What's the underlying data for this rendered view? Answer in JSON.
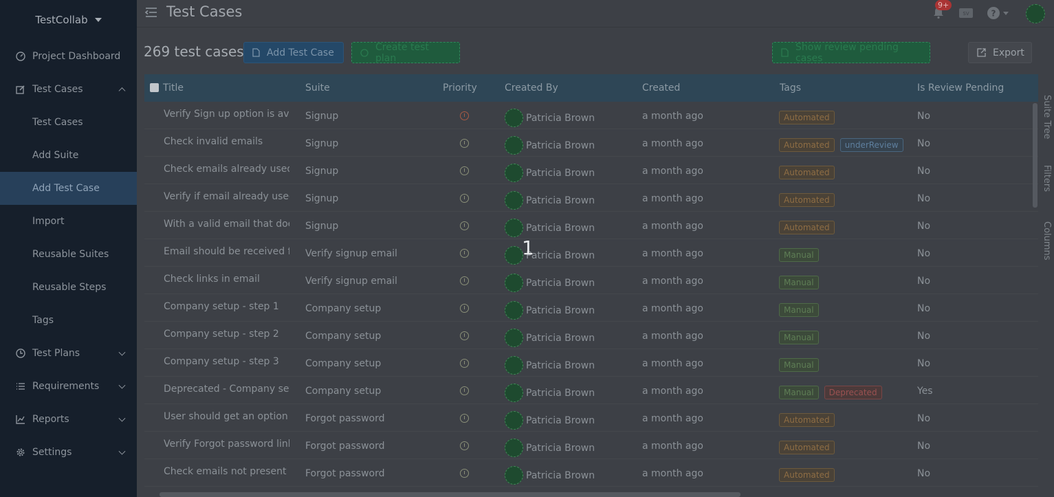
{
  "sidebar": {
    "brand": "TestCollab",
    "items": [
      {
        "label": "Project Dashboard",
        "icon": "dashboard-icon"
      },
      {
        "label": "Test Cases",
        "icon": "edit-icon"
      },
      {
        "label": "Test Cases"
      },
      {
        "label": "Add Suite"
      },
      {
        "label": "Add Test Case"
      },
      {
        "label": "Import"
      },
      {
        "label": "Reusable Suites"
      },
      {
        "label": "Reusable Steps"
      },
      {
        "label": "Tags"
      },
      {
        "label": "Test Plans",
        "icon": "clock-icon"
      },
      {
        "label": "Requirements",
        "icon": "list-icon"
      },
      {
        "label": "Reports",
        "icon": "chart-icon"
      },
      {
        "label": "Settings",
        "icon": "gear-icon"
      }
    ]
  },
  "header": {
    "title": "Test Cases",
    "notification_count": "9+"
  },
  "toolbar": {
    "count": "269 test cases",
    "add_test_case": "Add Test Case",
    "create_test_plan": "Create test plan",
    "show_review": "Show review pending cases",
    "export": "Export"
  },
  "table": {
    "columns": [
      "Title",
      "Suite",
      "Priority",
      "Created By",
      "Created",
      "Tags",
      "Is Review Pending"
    ],
    "rows": [
      {
        "title": "Verify Sign up option is available",
        "suite": "Signup",
        "priority": "high",
        "by": "Patricia Brown",
        "created": "a month ago",
        "tags": [
          "Automated"
        ],
        "review": "No"
      },
      {
        "title": "Check invalid emails",
        "suite": "Signup",
        "priority": "normal",
        "by": "Patricia Brown",
        "created": "a month ago",
        "tags": [
          "Automated",
          "underReview"
        ],
        "review": "No"
      },
      {
        "title": "Check emails already used",
        "suite": "Signup",
        "priority": "normal",
        "by": "Patricia Brown",
        "created": "a month ago",
        "tags": [
          "Automated"
        ],
        "review": "No"
      },
      {
        "title": "Verify if email already used, ...",
        "suite": "Signup",
        "priority": "normal",
        "by": "Patricia Brown",
        "created": "a month ago",
        "tags": [
          "Automated"
        ],
        "review": "No"
      },
      {
        "title": "With a valid email that does not exist",
        "suite": "Signup",
        "priority": "normal",
        "by": "Patricia Brown",
        "created": "a month ago",
        "tags": [
          "Automated"
        ],
        "review": "No"
      },
      {
        "title": "Email should be received for signup",
        "suite": "Verify signup email",
        "priority": "normal",
        "by": "Patricia Brown",
        "created": "a month ago",
        "tags": [
          "Manual"
        ],
        "review": "No"
      },
      {
        "title": "Check links in email",
        "suite": "Verify signup email",
        "priority": "normal",
        "by": "Patricia Brown",
        "created": "a month ago",
        "tags": [
          "Manual"
        ],
        "review": "No"
      },
      {
        "title": "Company setup - step 1",
        "suite": "Company setup",
        "priority": "normal",
        "by": "Patricia Brown",
        "created": "a month ago",
        "tags": [
          "Manual"
        ],
        "review": "No"
      },
      {
        "title": "Company setup - step 2",
        "suite": "Company setup",
        "priority": "normal",
        "by": "Patricia Brown",
        "created": "a month ago",
        "tags": [
          "Manual"
        ],
        "review": "No"
      },
      {
        "title": "Company setup - step 3",
        "suite": "Company setup",
        "priority": "normal",
        "by": "Patricia Brown",
        "created": "a month ago",
        "tags": [
          "Manual"
        ],
        "review": "No"
      },
      {
        "title": "Deprecated - Company setup",
        "suite": "Company setup",
        "priority": "normal",
        "by": "Patricia Brown",
        "created": "a month ago",
        "tags": [
          "Manual",
          "Deprecated"
        ],
        "review": "Yes"
      },
      {
        "title": "User should get an option to reset",
        "suite": "Forgot password",
        "priority": "normal",
        "by": "Patricia Brown",
        "created": "a month ago",
        "tags": [
          "Automated"
        ],
        "review": "No"
      },
      {
        "title": "Verify Forgot password link works",
        "suite": "Forgot password",
        "priority": "normal",
        "by": "Patricia Brown",
        "created": "a month ago",
        "tags": [
          "Automated"
        ],
        "review": "No"
      },
      {
        "title": "Check emails not present in system",
        "suite": "Forgot password",
        "priority": "normal",
        "by": "Patricia Brown",
        "created": "a month ago",
        "tags": [
          "Automated"
        ],
        "review": "No"
      }
    ]
  },
  "rail": {
    "suite_tree": "Suite Tree",
    "filters": "Filters",
    "columns": "Columns"
  },
  "overlay": "1"
}
